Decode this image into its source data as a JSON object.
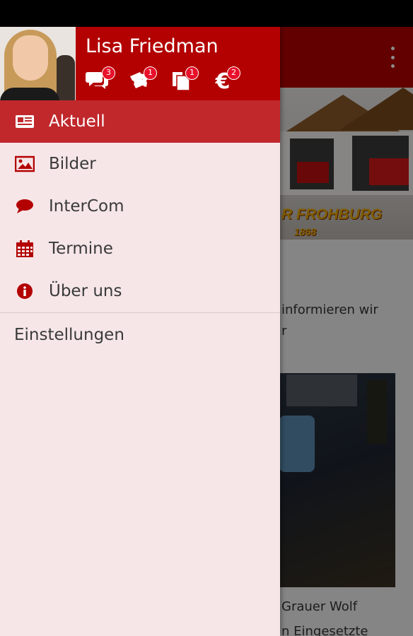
{
  "background_app": {
    "banner_title": "R FROHBURG",
    "banner_year": "1868",
    "text_lines": [
      "informieren wir",
      "r"
    ],
    "caption_lines": [
      "Grauer Wolf",
      "n Eingesetzte"
    ]
  },
  "drawer": {
    "user": {
      "name": "Lisa Friedman"
    },
    "header_icons": [
      {
        "icon": "chat-icon",
        "badge": "3"
      },
      {
        "icon": "tickets-icon",
        "badge": "1"
      },
      {
        "icon": "documents-icon",
        "badge": "1"
      },
      {
        "icon": "euro-icon",
        "badge": "2"
      }
    ],
    "nav_items": [
      {
        "label": "Aktuell",
        "icon": "newspaper-icon",
        "active": true
      },
      {
        "label": "Bilder",
        "icon": "image-icon",
        "active": false
      },
      {
        "label": "InterCom",
        "icon": "chat-bubble-icon",
        "active": false
      },
      {
        "label": "Termine",
        "icon": "calendar-icon",
        "active": false
      },
      {
        "label": "Über uns",
        "icon": "info-icon",
        "active": false
      }
    ],
    "settings_label": "Einstellungen"
  },
  "colors": {
    "primary": "#b30000",
    "active_item": "#c0282c",
    "drawer_bg": "#f6e6e8",
    "badge": "#e8102a"
  }
}
